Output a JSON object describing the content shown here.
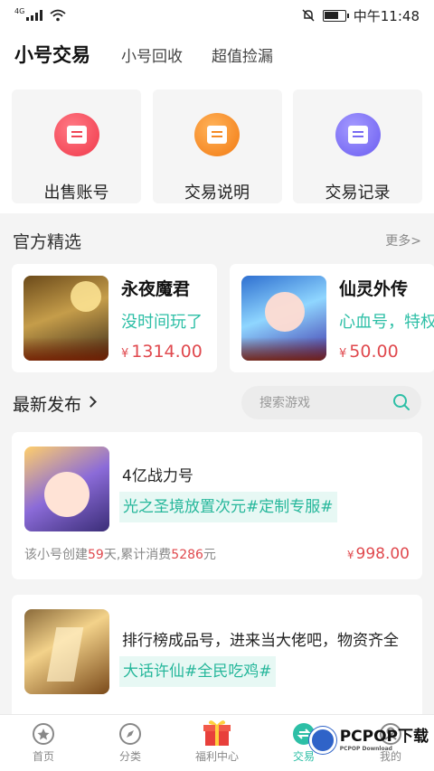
{
  "status_bar": {
    "network": "4G",
    "time": "中午11:48",
    "battery_level": 0.7
  },
  "top_nav": {
    "tabs": [
      "小号交易",
      "小号回收",
      "超值捡漏"
    ],
    "active": 0
  },
  "quick_actions": [
    {
      "label": "出售账号",
      "icon": "sell-account-icon",
      "color": "#f0384a"
    },
    {
      "label": "交易说明",
      "icon": "trade-info-icon",
      "color": "#f27a12"
    },
    {
      "label": "交易记录",
      "icon": "trade-record-icon",
      "color": "#6a5cf0"
    }
  ],
  "featured": {
    "title": "官方精选",
    "more": "更多>",
    "items": [
      {
        "name": "永夜魔君",
        "desc": "没时间玩了",
        "currency": "¥",
        "price": "1314.00"
      },
      {
        "name": "仙灵外传",
        "desc": "心血号，特权",
        "currency": "¥",
        "price": "50.00"
      }
    ]
  },
  "latest": {
    "title": "最新发布",
    "search_placeholder": "搜索游戏",
    "items": [
      {
        "title": "4亿战力号",
        "tags": "光之圣境放置次元#定制专服#",
        "meta_prefix": "该小号创建",
        "days": "59",
        "meta_mid": "天,累计消费",
        "spent": "5286",
        "meta_suffix": "元",
        "currency": "¥",
        "price": "998.00"
      },
      {
        "title": "排行榜成品号，进来当大佬吧，物资齐全",
        "tags": "大话许仙#全民吃鸡#"
      }
    ]
  },
  "tab_bar": {
    "items": [
      "首页",
      "分类",
      "福利中心",
      "交易",
      "我的"
    ],
    "active": 3
  },
  "watermark": {
    "text": "PCPOP下载",
    "sub": "PCPOP Download"
  },
  "colors": {
    "accent": "#2dbfa6",
    "price": "#e0494e",
    "tag_bg": "#e7f8f4"
  }
}
